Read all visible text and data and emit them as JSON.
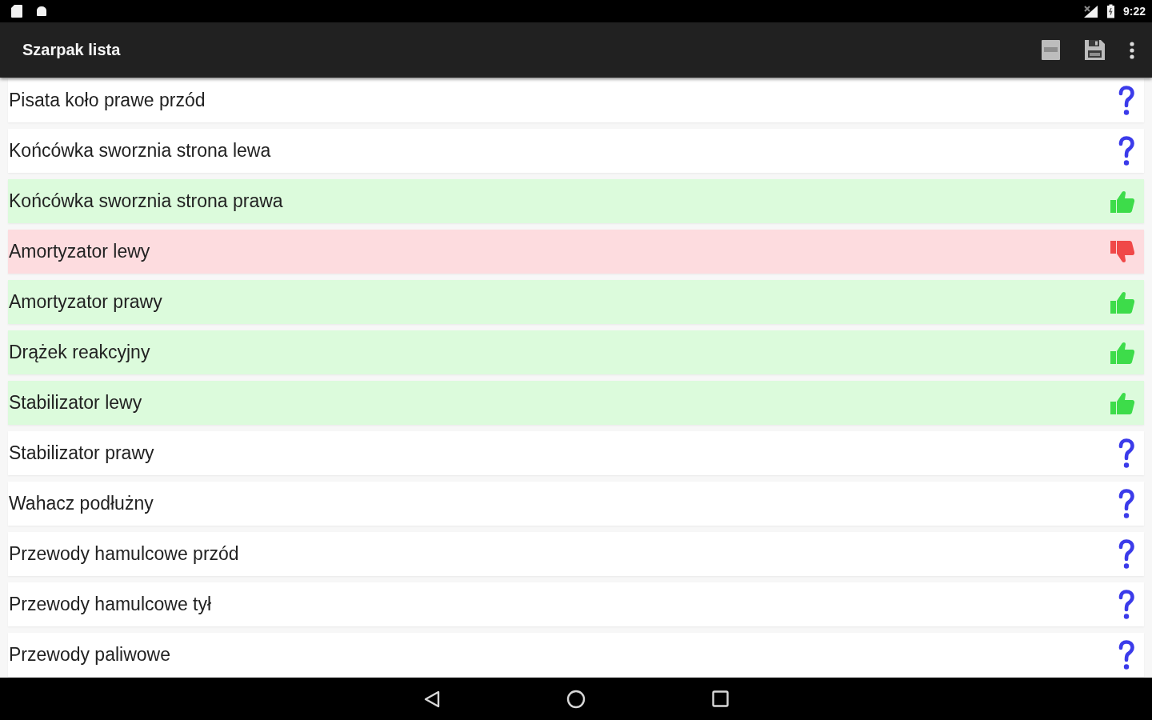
{
  "status_bar": {
    "time": "9:22"
  },
  "app_bar": {
    "title": "Szarpak lista"
  },
  "items": [
    {
      "label": "Pisata koło prawe przód",
      "kind": "unknown"
    },
    {
      "label": "Końcówka sworznia strona lewa",
      "kind": "unknown"
    },
    {
      "label": "Końcówka sworznia strona prawa",
      "kind": "pass"
    },
    {
      "label": "Amortyzator lewy",
      "kind": "fail"
    },
    {
      "label": "Amortyzator prawy",
      "kind": "pass"
    },
    {
      "label": "Drążek reakcyjny",
      "kind": "pass"
    },
    {
      "label": "Stabilizator lewy",
      "kind": "pass"
    },
    {
      "label": "Stabilizator prawy",
      "kind": "unknown"
    },
    {
      "label": "Wahacz podłużny",
      "kind": "unknown"
    },
    {
      "label": "Przewody hamulcowe przód",
      "kind": "unknown"
    },
    {
      "label": "Przewody hamulcowe tył",
      "kind": "unknown"
    },
    {
      "label": "Przewody paliwowe",
      "kind": "unknown"
    }
  ]
}
